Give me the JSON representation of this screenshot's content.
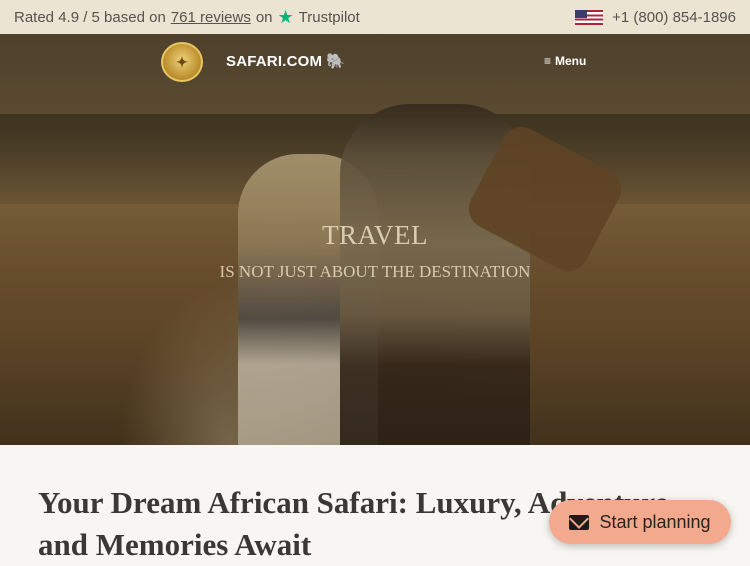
{
  "topbar": {
    "rating_prefix": "Rated 4.9 / 5 based on",
    "reviews_link": "761 reviews",
    "on_text": "on",
    "trustpilot_star": "★",
    "trustpilot": "Trustpilot",
    "phone": "+1 (800) 854-1896"
  },
  "nav": {
    "badge_text": "✦",
    "logo": "SAFARI.COM",
    "logo_animal": "🐘",
    "menu_icon": "≡",
    "menu_label": "Menu"
  },
  "hero": {
    "title": "TRAVEL",
    "subtitle": "IS NOT JUST ABOUT THE DESTINATION"
  },
  "main": {
    "headline": "Your Dream African Safari: Luxury, Adventure, and Memories Await"
  },
  "cta": {
    "label": "Start planning"
  },
  "colors": {
    "topbar_bg": "#ece4d2",
    "trustpilot_green": "#00b67a",
    "cta_bg": "#f2a98e"
  }
}
